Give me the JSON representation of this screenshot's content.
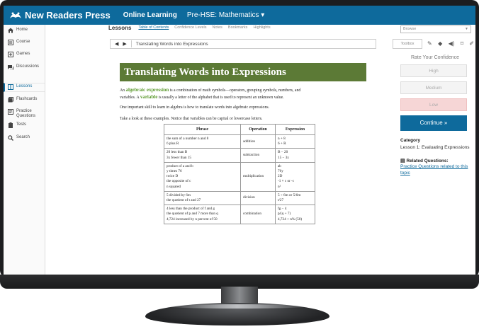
{
  "app": {
    "brand": "New Readers Press",
    "nav_link": "Online Learning",
    "course_menu": "Pre-HSE: Mathematics ▾"
  },
  "sidebar": {
    "items": [
      {
        "label": "Home"
      },
      {
        "label": "Course"
      },
      {
        "label": "Games"
      },
      {
        "label": "Discussions"
      },
      {
        "label": "Lessons"
      },
      {
        "label": "Flashcards"
      },
      {
        "label": "Practice Questions"
      },
      {
        "label": "Tests"
      },
      {
        "label": "Search"
      }
    ]
  },
  "tabs": {
    "title": "Lessons",
    "items": [
      "Table of Contents",
      "Confidence Levels",
      "Notes",
      "Bookmarks",
      "Highlights"
    ]
  },
  "browse": {
    "label": "Browse"
  },
  "navbar": {
    "breadcrumb": "Translating Words into Expressions",
    "toolbox": "Toolbox"
  },
  "lesson": {
    "heading": "Translating Words into Expressions",
    "p1_a": "An ",
    "p1_kw1": "algebraic expression",
    "p1_b": " is a combination of math symbols—operators, grouping symbols, numbers, and",
    "p1_c": "variables. A ",
    "p1_kw2": "variable",
    "p1_d": " is usually a letter of the alphabet that is used to represent an unknown value.",
    "p2": "One important skill to learn in algebra is how to translate words into algebraic expressions.",
    "p3": "Take a look at these examples. Notice that variables can be capital or lowercase letters.",
    "table": {
      "headers": [
        "Phrase",
        "Operation",
        "Expression"
      ],
      "rows": [
        {
          "phrase": [
            "the sum of a number n and 8",
            "6 plus R"
          ],
          "operation": "addition",
          "expression": [
            "n + 8",
            "6 + R"
          ]
        },
        {
          "phrase": [
            "20 less than B",
            "3x fewer than 15"
          ],
          "operation": "subtraction",
          "expression": [
            "B − 20",
            "15 − 3x"
          ]
        },
        {
          "phrase": [
            "product of a and b",
            "y times 76",
            "twice D",
            "the opposite of c",
            "n squared"
          ],
          "operation": "multiplication",
          "expression": [
            "ab",
            "76y",
            "2D",
            "-1 × c or -c",
            "n²"
          ]
        },
        {
          "phrase": [
            "5 divided by 6m",
            "the quotient of t and 27"
          ],
          "operation": "division",
          "expression": [
            "5 ÷ 6m or 5/6m",
            "t/27"
          ]
        },
        {
          "phrase": [
            "4 less than the product of f and g",
            "the quotient of p and 7 more than q",
            "4,724 increased by n percent of 50"
          ],
          "operation": "combination",
          "expression": [
            "fg − 4",
            "p/(q + 7)",
            "4,724 + n% (50)"
          ]
        }
      ]
    }
  },
  "right_panel": {
    "rate_title": "Rate Your Confidence",
    "high": "High",
    "medium": "Medium",
    "low": "Low",
    "continue": "Continue »",
    "category_title": "Category",
    "category_value": "Lesson 1: Evaluating Expressions",
    "related_title": "Related Questions:",
    "related_link": "Practice Questions related to this topic"
  }
}
